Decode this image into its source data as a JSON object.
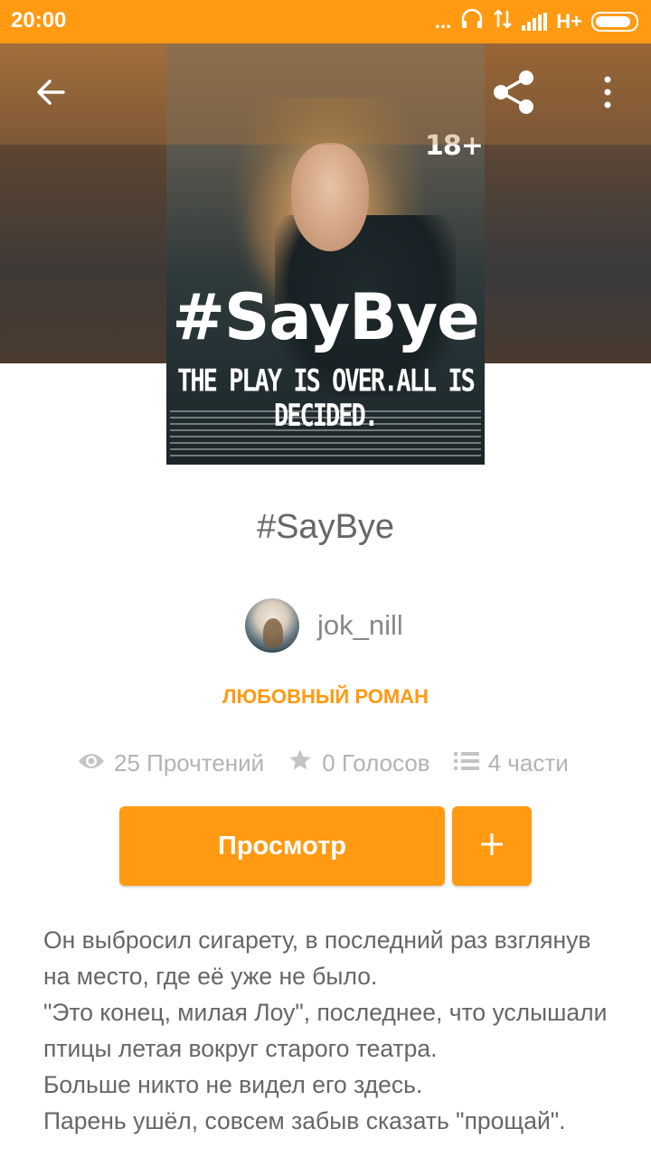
{
  "status_bar": {
    "time": "20:00",
    "dots": "...",
    "network": "H+"
  },
  "toolbar": {
    "back_icon": "arrow-left-icon",
    "share_icon": "share-icon",
    "more_icon": "more-vert-icon"
  },
  "cover": {
    "age_rating": "18+",
    "title": "#SayBye",
    "tagline": "THE PLAY IS OVER.ALL IS DECIDED."
  },
  "story": {
    "title": "#SayBye",
    "author": "jok_nill",
    "category": "ЛЮБОВНЫЙ РОМАН"
  },
  "stats": {
    "reads": "25 Прочтений",
    "votes": "0 Голосов",
    "parts": "4 части"
  },
  "actions": {
    "read_label": "Просмотр",
    "add_label": "+"
  },
  "description": [
    "Он выбросил сигарету, в последний раз взглянув на место, где её уже не было.",
    "\"Это конец, милая Лоу\", последнее, что услышали птицы летая вокруг старого театра.",
    "Больше никто не видел его здесь.",
    "Парень ушёл, совсем забыв сказать \"прощай\"."
  ],
  "colors": {
    "accent": "#ff9a12",
    "text_muted": "#666666",
    "stats_gray": "#b3b3b3"
  }
}
